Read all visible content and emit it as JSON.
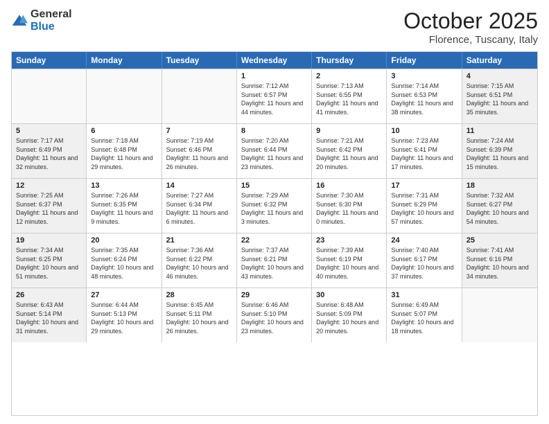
{
  "logo": {
    "general": "General",
    "blue": "Blue"
  },
  "header": {
    "month": "October 2025",
    "location": "Florence, Tuscany, Italy"
  },
  "weekdays": [
    "Sunday",
    "Monday",
    "Tuesday",
    "Wednesday",
    "Thursday",
    "Friday",
    "Saturday"
  ],
  "weeks": [
    [
      {
        "day": "",
        "info": ""
      },
      {
        "day": "",
        "info": ""
      },
      {
        "day": "",
        "info": ""
      },
      {
        "day": "1",
        "info": "Sunrise: 7:12 AM\nSunset: 6:57 PM\nDaylight: 11 hours and 44 minutes."
      },
      {
        "day": "2",
        "info": "Sunrise: 7:13 AM\nSunset: 6:55 PM\nDaylight: 11 hours and 41 minutes."
      },
      {
        "day": "3",
        "info": "Sunrise: 7:14 AM\nSunset: 6:53 PM\nDaylight: 11 hours and 38 minutes."
      },
      {
        "day": "4",
        "info": "Sunrise: 7:15 AM\nSunset: 6:51 PM\nDaylight: 11 hours and 35 minutes."
      }
    ],
    [
      {
        "day": "5",
        "info": "Sunrise: 7:17 AM\nSunset: 6:49 PM\nDaylight: 11 hours and 32 minutes."
      },
      {
        "day": "6",
        "info": "Sunrise: 7:18 AM\nSunset: 6:48 PM\nDaylight: 11 hours and 29 minutes."
      },
      {
        "day": "7",
        "info": "Sunrise: 7:19 AM\nSunset: 6:46 PM\nDaylight: 11 hours and 26 minutes."
      },
      {
        "day": "8",
        "info": "Sunrise: 7:20 AM\nSunset: 6:44 PM\nDaylight: 11 hours and 23 minutes."
      },
      {
        "day": "9",
        "info": "Sunrise: 7:21 AM\nSunset: 6:42 PM\nDaylight: 11 hours and 20 minutes."
      },
      {
        "day": "10",
        "info": "Sunrise: 7:23 AM\nSunset: 6:41 PM\nDaylight: 11 hours and 17 minutes."
      },
      {
        "day": "11",
        "info": "Sunrise: 7:24 AM\nSunset: 6:39 PM\nDaylight: 11 hours and 15 minutes."
      }
    ],
    [
      {
        "day": "12",
        "info": "Sunrise: 7:25 AM\nSunset: 6:37 PM\nDaylight: 11 hours and 12 minutes."
      },
      {
        "day": "13",
        "info": "Sunrise: 7:26 AM\nSunset: 6:35 PM\nDaylight: 11 hours and 9 minutes."
      },
      {
        "day": "14",
        "info": "Sunrise: 7:27 AM\nSunset: 6:34 PM\nDaylight: 11 hours and 6 minutes."
      },
      {
        "day": "15",
        "info": "Sunrise: 7:29 AM\nSunset: 6:32 PM\nDaylight: 11 hours and 3 minutes."
      },
      {
        "day": "16",
        "info": "Sunrise: 7:30 AM\nSunset: 6:30 PM\nDaylight: 11 hours and 0 minutes."
      },
      {
        "day": "17",
        "info": "Sunrise: 7:31 AM\nSunset: 6:29 PM\nDaylight: 10 hours and 57 minutes."
      },
      {
        "day": "18",
        "info": "Sunrise: 7:32 AM\nSunset: 6:27 PM\nDaylight: 10 hours and 54 minutes."
      }
    ],
    [
      {
        "day": "19",
        "info": "Sunrise: 7:34 AM\nSunset: 6:25 PM\nDaylight: 10 hours and 51 minutes."
      },
      {
        "day": "20",
        "info": "Sunrise: 7:35 AM\nSunset: 6:24 PM\nDaylight: 10 hours and 48 minutes."
      },
      {
        "day": "21",
        "info": "Sunrise: 7:36 AM\nSunset: 6:22 PM\nDaylight: 10 hours and 46 minutes."
      },
      {
        "day": "22",
        "info": "Sunrise: 7:37 AM\nSunset: 6:21 PM\nDaylight: 10 hours and 43 minutes."
      },
      {
        "day": "23",
        "info": "Sunrise: 7:39 AM\nSunset: 6:19 PM\nDaylight: 10 hours and 40 minutes."
      },
      {
        "day": "24",
        "info": "Sunrise: 7:40 AM\nSunset: 6:17 PM\nDaylight: 10 hours and 37 minutes."
      },
      {
        "day": "25",
        "info": "Sunrise: 7:41 AM\nSunset: 6:16 PM\nDaylight: 10 hours and 34 minutes."
      }
    ],
    [
      {
        "day": "26",
        "info": "Sunrise: 6:43 AM\nSunset: 5:14 PM\nDaylight: 10 hours and 31 minutes."
      },
      {
        "day": "27",
        "info": "Sunrise: 6:44 AM\nSunset: 5:13 PM\nDaylight: 10 hours and 29 minutes."
      },
      {
        "day": "28",
        "info": "Sunrise: 6:45 AM\nSunset: 5:11 PM\nDaylight: 10 hours and 26 minutes."
      },
      {
        "day": "29",
        "info": "Sunrise: 6:46 AM\nSunset: 5:10 PM\nDaylight: 10 hours and 23 minutes."
      },
      {
        "day": "30",
        "info": "Sunrise: 6:48 AM\nSunset: 5:09 PM\nDaylight: 10 hours and 20 minutes."
      },
      {
        "day": "31",
        "info": "Sunrise: 6:49 AM\nSunset: 5:07 PM\nDaylight: 10 hours and 18 minutes."
      },
      {
        "day": "",
        "info": ""
      }
    ]
  ]
}
